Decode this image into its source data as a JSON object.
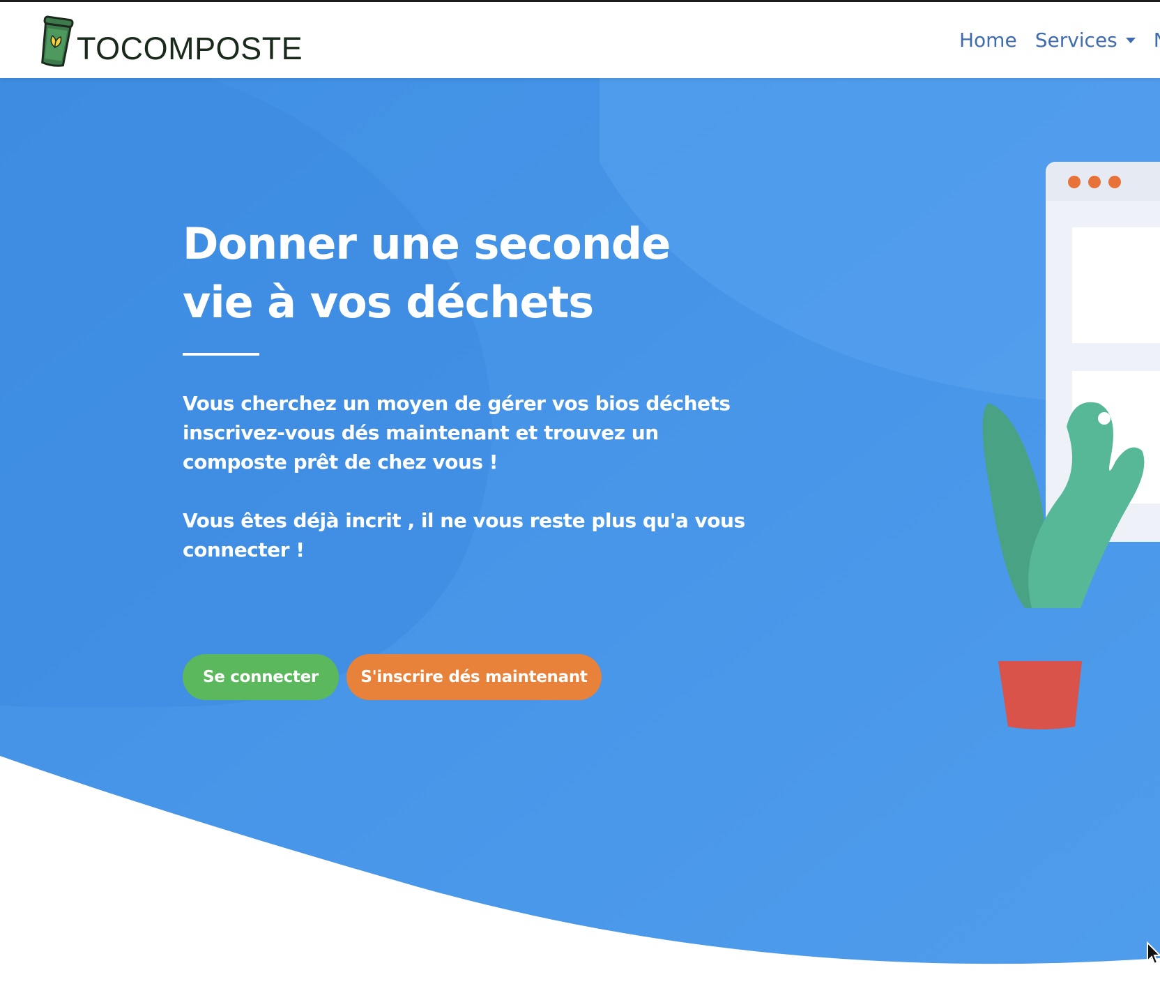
{
  "brand": {
    "name": "TOCOMPOSTE",
    "logo_icon": "compost-bin-icon"
  },
  "nav": {
    "items": [
      {
        "label": "Home"
      },
      {
        "label": "Services",
        "dropdown": true
      },
      {
        "label": "N"
      }
    ]
  },
  "hero": {
    "title": "Donner une seconde vie à vos déchets",
    "paragraph1": "Vous cherchez un moyen de gérer vos bios déchets inscrivez-vous dés maintenant et trouvez un composte prêt de chez vous !",
    "paragraph2": "Vous êtes déjà incrit , il ne vous reste plus qu'a vous connecter !",
    "login_button": "Se connecter",
    "signup_button": "S'inscrire dés maintenant"
  },
  "colors": {
    "hero_blue": "#4192e6",
    "nav_link": "#3f6cae",
    "login_green": "#5cb85c",
    "signup_orange": "#e8823a",
    "window_dots": "#e8733a",
    "plant_green": "#56b896",
    "pot_red": "#d9534a"
  }
}
